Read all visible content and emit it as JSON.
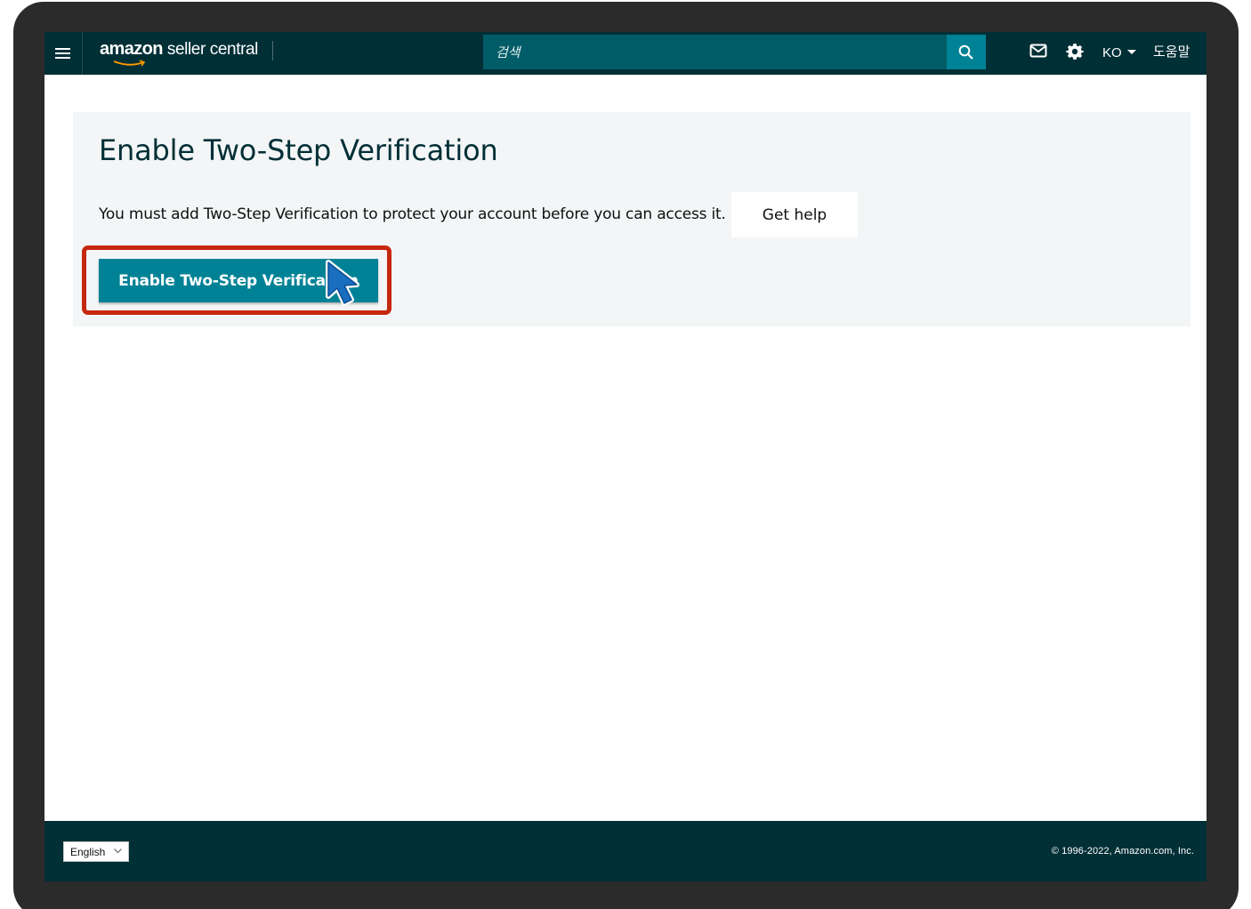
{
  "header": {
    "brand_amazon": "amazon",
    "brand_rest": "seller central",
    "search_placeholder": "검색",
    "language": "KO",
    "help": "도움말"
  },
  "icons": {
    "menu": "hamburger-icon",
    "search": "search-icon",
    "mail": "mail-icon",
    "settings": "gear-icon",
    "dropdown": "caret-down-icon",
    "cursor": "mouse-pointer-icon"
  },
  "main": {
    "title": "Enable Two-Step Verification",
    "message": "You must add Two-Step Verification to protect your account before you can access it.",
    "get_help_label": "Get help",
    "enable_button_label": "Enable Two-Step Verification"
  },
  "footer": {
    "language_select": "English",
    "copyright": "© 1996-2022, Amazon.com, Inc."
  },
  "colors": {
    "nav_background": "#002f36",
    "search_background": "#005c67",
    "accent": "#008296",
    "highlight": "#c6280e",
    "cursor": "#1a6ec0"
  }
}
